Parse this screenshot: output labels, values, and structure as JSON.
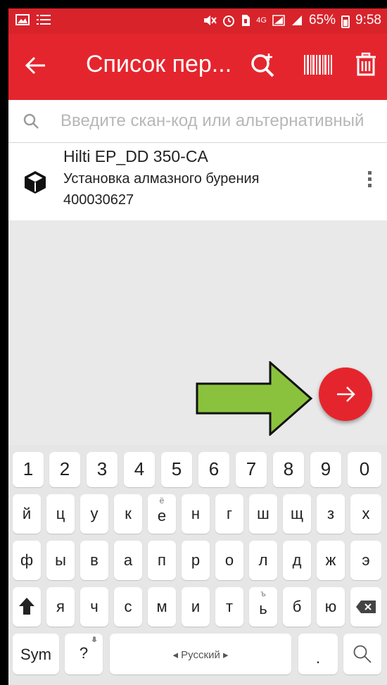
{
  "status_bar": {
    "battery": "65%",
    "time": "9:58",
    "network": "4G"
  },
  "toolbar": {
    "title": "Список пер...",
    "back_icon": "arrow-left-icon",
    "icons": [
      "search-add-icon",
      "barcode-icon",
      "trash-icon"
    ]
  },
  "search": {
    "placeholder": "Введите скан-код или альтернативный"
  },
  "list": {
    "items": [
      {
        "name": "Hilti EP_DD 350-CA",
        "description": "Установка алмазного бурения",
        "code": "400030627",
        "icon": "cube-icon"
      }
    ]
  },
  "colors": {
    "primary": "#e5252d",
    "status_bar": "#d8232b",
    "annotation_arrow": "#8ac23e"
  },
  "keyboard": {
    "language": "◂ Русский ▸",
    "row1": [
      "1",
      "2",
      "3",
      "4",
      "5",
      "6",
      "7",
      "8",
      "9",
      "0"
    ],
    "row2": [
      "й",
      "ц",
      "у",
      "к",
      "е",
      "н",
      "г",
      "ш",
      "щ",
      "з",
      "х"
    ],
    "row3": [
      "ф",
      "ы",
      "в",
      "а",
      "п",
      "р",
      "о",
      "л",
      "д",
      "ж",
      "э"
    ],
    "row4": [
      "я",
      "ч",
      "с",
      "м",
      "и",
      "т",
      "ь",
      "б",
      "ю"
    ],
    "hints": {
      "е": "ё",
      "ь": "ъ"
    },
    "sym": "Sym",
    "question": "?",
    "period": "."
  }
}
